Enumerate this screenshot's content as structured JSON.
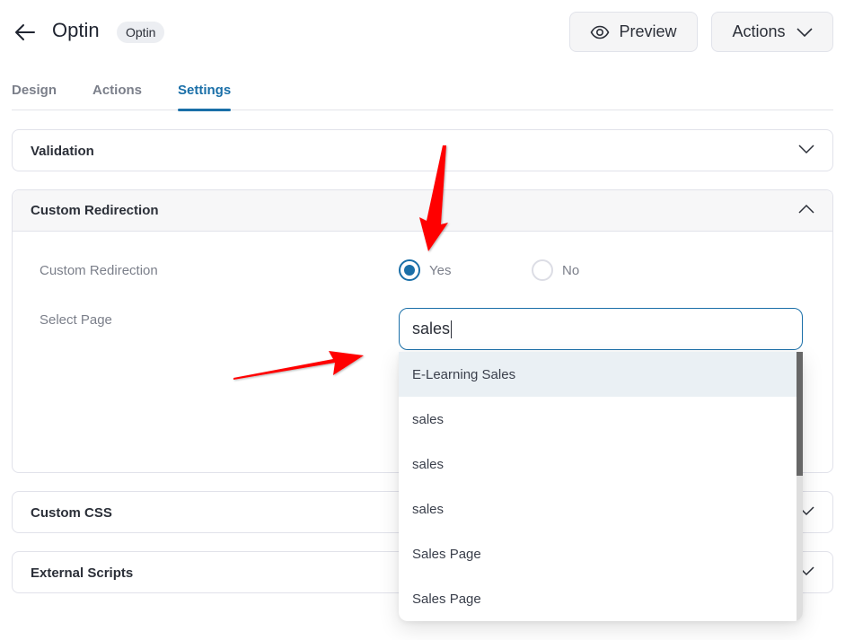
{
  "header": {
    "back_icon": "arrow-left-icon",
    "title": "Optin",
    "badge": "Optin",
    "preview_label": "Preview",
    "preview_icon": "eye-icon",
    "actions_label": "Actions",
    "actions_icon": "chevron-down-icon"
  },
  "tabs": [
    {
      "label": "Design",
      "active": false
    },
    {
      "label": "Actions",
      "active": false
    },
    {
      "label": "Settings",
      "active": true
    }
  ],
  "panels": {
    "validation": {
      "title": "Validation",
      "expanded": false
    },
    "custom_redirection": {
      "title": "Custom Redirection",
      "expanded": true,
      "redirect_label": "Custom Redirection",
      "options": [
        {
          "label": "Yes",
          "checked": true
        },
        {
          "label": "No",
          "checked": false
        }
      ],
      "select_page_label": "Select Page",
      "search_value": "sales"
    },
    "custom_css": {
      "title": "Custom CSS",
      "expanded": false
    },
    "external_scripts": {
      "title": "External Scripts",
      "expanded": false
    }
  },
  "dropdown": {
    "items": [
      {
        "label": "E-Learning Sales",
        "highlighted": true
      },
      {
        "label": "sales",
        "highlighted": false
      },
      {
        "label": "sales",
        "highlighted": false
      },
      {
        "label": "sales",
        "highlighted": false
      },
      {
        "label": "Sales Page",
        "highlighted": false
      },
      {
        "label": "Sales Page",
        "highlighted": false
      }
    ]
  },
  "colors": {
    "accent": "#1a6fa8",
    "annotation_arrow": "#ff0000",
    "highlight_row": "#eaf0f4"
  }
}
